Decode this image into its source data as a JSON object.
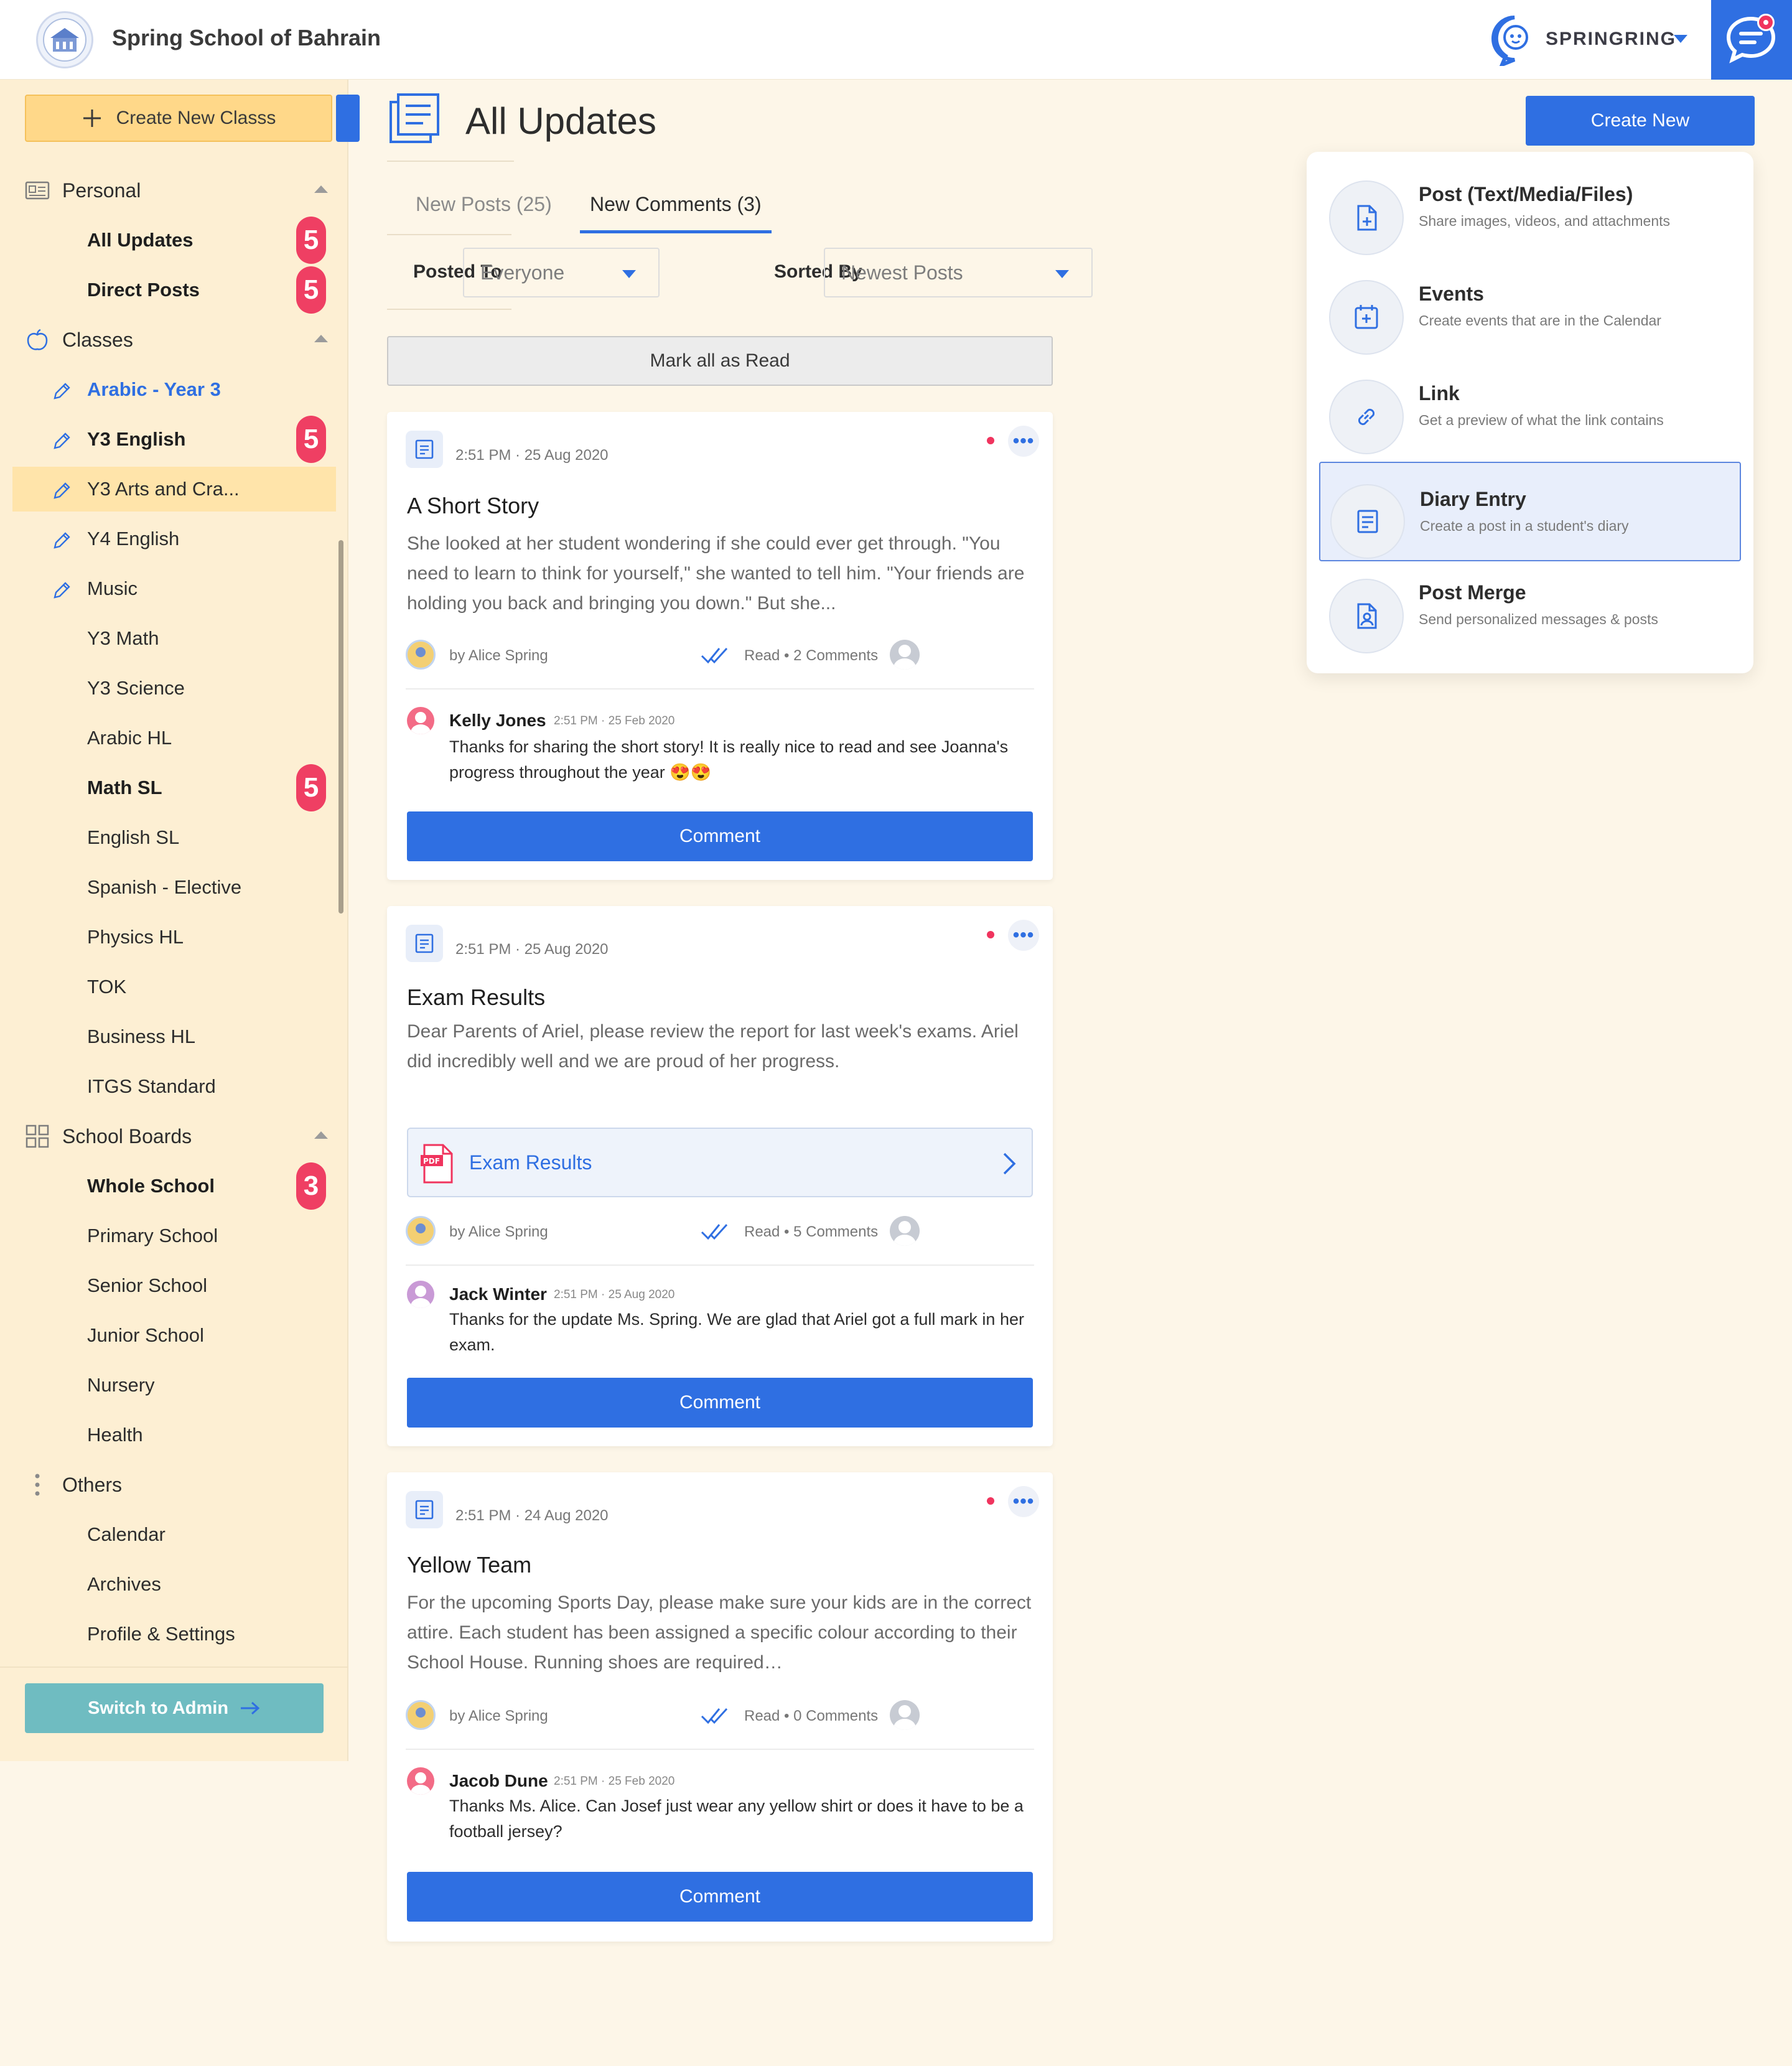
{
  "header": {
    "school_name": "Spring School of Bahrain",
    "brand_name": "SPRINGRING"
  },
  "colors": {
    "primary": "#2f6fe2",
    "sidebar_bg": "#fdefd3",
    "page_bg": "#fdf6e8",
    "badge": "#ef3f63",
    "admin_button": "#6fbcc1"
  },
  "sidebar": {
    "create_class_label": "Create New Classs",
    "sections": {
      "personal": "Personal",
      "classes": "Classes",
      "school_boards": "School Boards",
      "others": "Others"
    },
    "personal_items": [
      {
        "label": "All Updates",
        "badge": "5"
      },
      {
        "label": "Direct Posts",
        "badge": "5"
      }
    ],
    "class_items": [
      {
        "label": "Arabic - Year 3"
      },
      {
        "label": "Y3 English",
        "badge": "5"
      },
      {
        "label": "Y3 Arts and Cra..."
      },
      {
        "label": "Y4 English"
      },
      {
        "label": "Music"
      },
      {
        "label": "Y3 Math"
      },
      {
        "label": "Y3 Science"
      },
      {
        "label": "Arabic HL"
      },
      {
        "label": "Math SL",
        "badge": "5"
      },
      {
        "label": "English SL"
      },
      {
        "label": "Spanish - Elective"
      },
      {
        "label": "Physics HL"
      },
      {
        "label": "TOK"
      },
      {
        "label": "Business HL"
      },
      {
        "label": "ITGS Standard"
      }
    ],
    "board_items": [
      {
        "label": "Whole School",
        "badge": "3"
      },
      {
        "label": "Primary School"
      },
      {
        "label": "Senior School"
      },
      {
        "label": "Junior School"
      },
      {
        "label": "Nursery"
      },
      {
        "label": "Health"
      }
    ],
    "other_items": [
      {
        "label": "Calendar"
      },
      {
        "label": "Archives"
      },
      {
        "label": "Profile & Settings"
      }
    ],
    "switch_admin_label": "Switch to Admin"
  },
  "main": {
    "title": "All Updates",
    "create_new_label": "Create New",
    "tabs": [
      {
        "label": "New Posts (25)"
      },
      {
        "label": "New Comments (3)"
      }
    ],
    "filters": {
      "posted_to_label": "Posted To",
      "posted_to_value": "Everyone",
      "sorted_by_label": "Sorted By",
      "sorted_by_value": "Newest Posts"
    },
    "mark_all_read_label": "Mark all as Read",
    "comment_button_label": "Comment",
    "posts": [
      {
        "time": "2:51 PM · 25 Aug 2020",
        "title": "A Short Story",
        "body": "She looked at her student wondering if she could ever get through. \"You need to learn to think for yourself,\" she wanted to tell him. \"Your friends are holding you back and bringing you down.\" But she...",
        "author": "by Alice Spring",
        "read_info": "Read • 2 Comments",
        "comment": {
          "name": "Kelly Jones",
          "time": "2:51 PM · 25 Feb 2020",
          "text": "Thanks for sharing the short story! It is really nice to read and see Joanna's progress throughout the year 😍😍"
        }
      },
      {
        "time": "2:51 PM · 25 Aug 2020",
        "title": "Exam Results",
        "body": "Dear Parents of Ariel, please review the report for last week's exams. Ariel did incredibly well and we are proud of her progress.",
        "attachment": "Exam Results",
        "author": "by Alice Spring",
        "read_info": "Read • 5 Comments",
        "comment": {
          "name": "Jack Winter",
          "time": "2:51 PM · 25 Aug 2020",
          "text": "Thanks for the update Ms. Spring. We are glad that Ariel got a full mark in her exam."
        }
      },
      {
        "time": "2:51 PM · 24 Aug 2020",
        "title": "Yellow Team",
        "body": "For the upcoming Sports Day, please make sure your kids are in the correct attire. Each student has been assigned a specific colour according to their School House. Running shoes are required…",
        "author": "by Alice Spring",
        "read_info": "Read • 0 Comments",
        "comment": {
          "name": "Jacob Dune",
          "time": "2:51 PM · 25 Feb 2020",
          "text": "Thanks Ms. Alice. Can Josef just wear any yellow shirt or does it have to be a football jersey?"
        }
      }
    ]
  },
  "dropdown": {
    "items": [
      {
        "title": "Post (Text/Media/Files)",
        "subtitle": "Share images, videos, and attachments",
        "icon": "add-file-icon"
      },
      {
        "title": "Events",
        "subtitle": "Create events that are in the Calendar",
        "icon": "calendar-plus-icon"
      },
      {
        "title": "Link",
        "subtitle": "Get a preview of what the link contains",
        "icon": "link-icon"
      },
      {
        "title": "Diary Entry",
        "subtitle": "Create a post in a student's diary",
        "icon": "diary-icon"
      },
      {
        "title": "Post Merge",
        "subtitle": "Send personalized messages & posts",
        "icon": "post-merge-icon"
      }
    ]
  }
}
